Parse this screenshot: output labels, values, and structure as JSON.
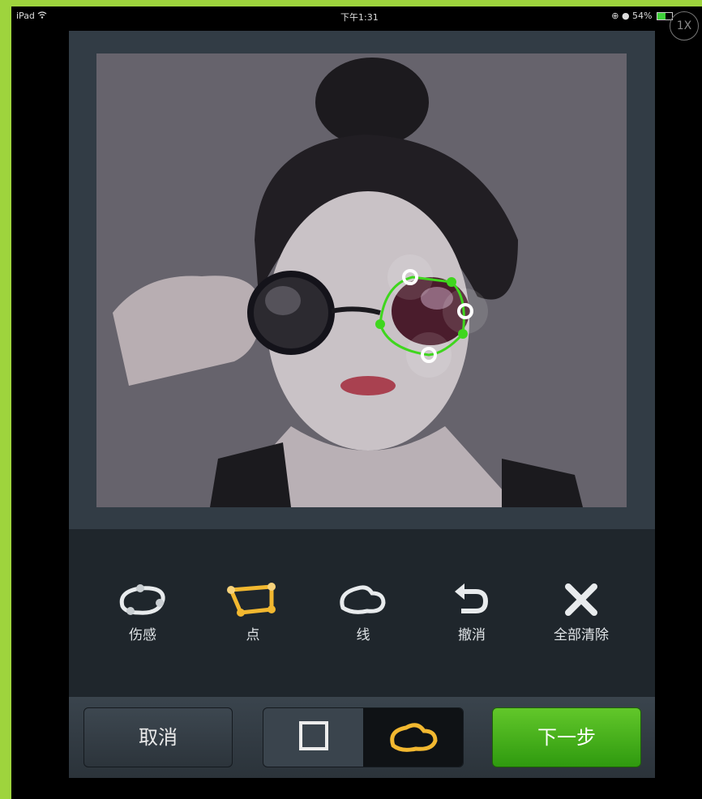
{
  "status_bar": {
    "device": "iPad",
    "wifi_icon": "wifi-icon",
    "time": "下午1:31",
    "battery_percent": "54%",
    "battery_level": 0.54
  },
  "zoom_badge": "1X",
  "colors": {
    "accent_green": "#3fc21a",
    "highlight_yellow": "#f2b830",
    "panel": "#323c45",
    "toolbar_bg": "#1f262c"
  },
  "tools": [
    {
      "label": "伤感",
      "icon": "lasso-icon"
    },
    {
      "label": "点",
      "icon": "polygon-points-icon"
    },
    {
      "label": "线",
      "icon": "freeform-line-icon"
    },
    {
      "label": "撤消",
      "icon": "undo-icon"
    },
    {
      "label": "全部清除",
      "icon": "clear-all-icon"
    }
  ],
  "bottom_bar": {
    "cancel_label": "取消",
    "shape_options": [
      {
        "icon": "square-shape-icon",
        "selected": false
      },
      {
        "icon": "freeform-shape-icon",
        "selected": true
      }
    ],
    "next_label": "下一步"
  }
}
